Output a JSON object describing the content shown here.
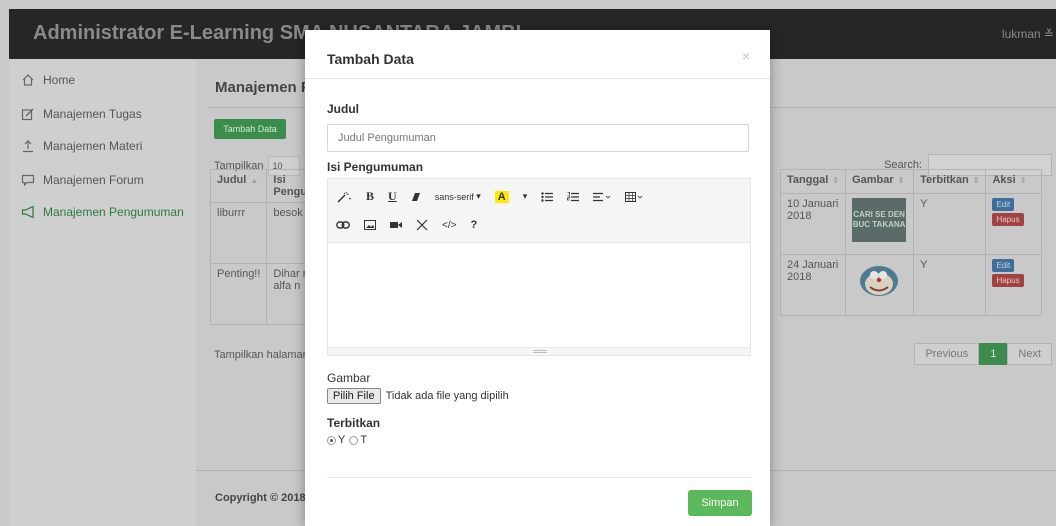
{
  "navbar": {
    "brand": "Administrator E-Learning SMA NUSANTARA JAMBI",
    "user": "lukman ≚"
  },
  "sidebar": {
    "items": [
      {
        "label": "Home",
        "icon": "home-icon"
      },
      {
        "label": "Manajemen Tugas",
        "icon": "edit-icon"
      },
      {
        "label": "Manajemen Materi",
        "icon": "upload-icon"
      },
      {
        "label": "Manajemen Forum",
        "icon": "comment-icon"
      },
      {
        "label": "Manajemen Pengumuman",
        "icon": "megaphone-icon"
      }
    ],
    "active_index": 4
  },
  "main": {
    "title": "Manajemen Pengumuman",
    "add_button": "Tambah Data",
    "length_label": "Tampilkan",
    "length_value": "10",
    "search_label": "Search:",
    "columns_left": [
      "Judul",
      "Isi Pengumuman"
    ],
    "columns_right": [
      "Tanggal",
      "Gambar",
      "Terbitkan",
      "Aksi"
    ],
    "rows": [
      {
        "judul": "liburrr",
        "isi": "besok",
        "tanggal": "10 Januari 2018",
        "gambar_text": "CARI SE DEN BUC TAKANA",
        "terbitkan": "Y"
      },
      {
        "judul": "Penting!!",
        "isi": "Dihar meng alfa n",
        "tanggal": "24 Januari 2018",
        "gambar_text": "",
        "terbitkan": "Y"
      }
    ],
    "edit_label": "Edit",
    "delete_label": "Hapus",
    "info": "Tampilkan halaman",
    "pagination": {
      "previous": "Previous",
      "current": "1",
      "next": "Next"
    },
    "footer": "Copyright © 2018"
  },
  "modal": {
    "title": "Tambah Data",
    "close": "×",
    "judul_label": "Judul",
    "judul_placeholder": "Judul Pengumuman",
    "isi_label": "Isi Pengumuman",
    "toolbar": {
      "font_name": "sans-serif",
      "highlight_letter": "A",
      "code_symbol": "</>",
      "help_symbol": "?"
    },
    "gambar_label": "Gambar",
    "file_button": "Pilih File",
    "file_status": "Tidak ada file yang dipilih",
    "terbitkan_label": "Terbitkan",
    "radio_y": "Y",
    "radio_t": "T",
    "save_button": "Simpan"
  },
  "colors": {
    "accent_green": "#5cb85c",
    "navbar": "#262626",
    "active_menu": "#2f7a44"
  }
}
